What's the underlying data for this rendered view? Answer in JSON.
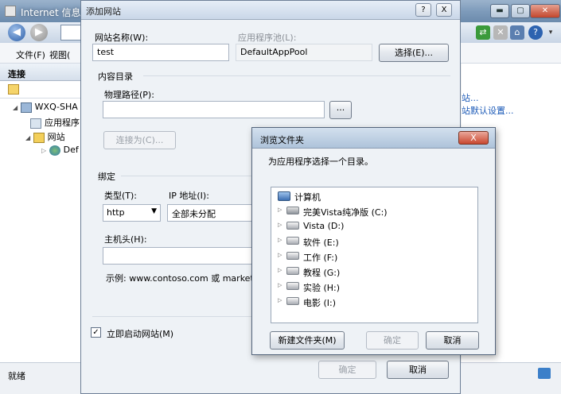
{
  "iis": {
    "title": "Internet 信息服务",
    "menu": [
      "文件(F)",
      "视图("
    ],
    "left_panel_title": "连接",
    "tree": [
      "WXQ-SHA",
      "应用程序",
      "网站",
      "Def"
    ],
    "right_links": [
      "站...",
      "站默认设置..."
    ],
    "status": "就绪"
  },
  "dialog": {
    "title": "添加网站",
    "help_btn": "?",
    "close_btn": "X",
    "site_name_label": "网站名称(W):",
    "site_name_value": "test",
    "app_pool_label": "应用程序池(L):",
    "app_pool_value": "DefaultAppPool",
    "select_button": "选择(E)...",
    "content_dir_label": "内容目录",
    "physical_path_label": "物理路径(P):",
    "physical_path_value": "",
    "browse_button": "...",
    "connect_as_button": "连接为(C)...",
    "binding_label": "绑定",
    "type_label": "类型(T):",
    "type_value": "http",
    "ip_label": "IP 地址(I):",
    "ip_value": "全部未分配",
    "host_label": "主机头(H):",
    "host_value": "",
    "example_text": "示例: www.contoso.com 或 marketi",
    "start_site_label": "立即启动网站(M)",
    "start_site_checked": true,
    "ok_button": "确定",
    "cancel_button": "取消"
  },
  "browse": {
    "title": "浏览文件夹",
    "close_btn": "X",
    "prompt": "为应用程序选择一个目录。",
    "root": "计算机",
    "drives": [
      "完美Vista纯净版 (C:)",
      "Vista (D:)",
      "软件 (E:)",
      "工作 (F:)",
      "教程 (G:)",
      "实验 (H:)",
      "电影 (I:)"
    ],
    "new_folder_button": "新建文件夹(M)",
    "ok_button": "确定",
    "cancel_button": "取消"
  }
}
